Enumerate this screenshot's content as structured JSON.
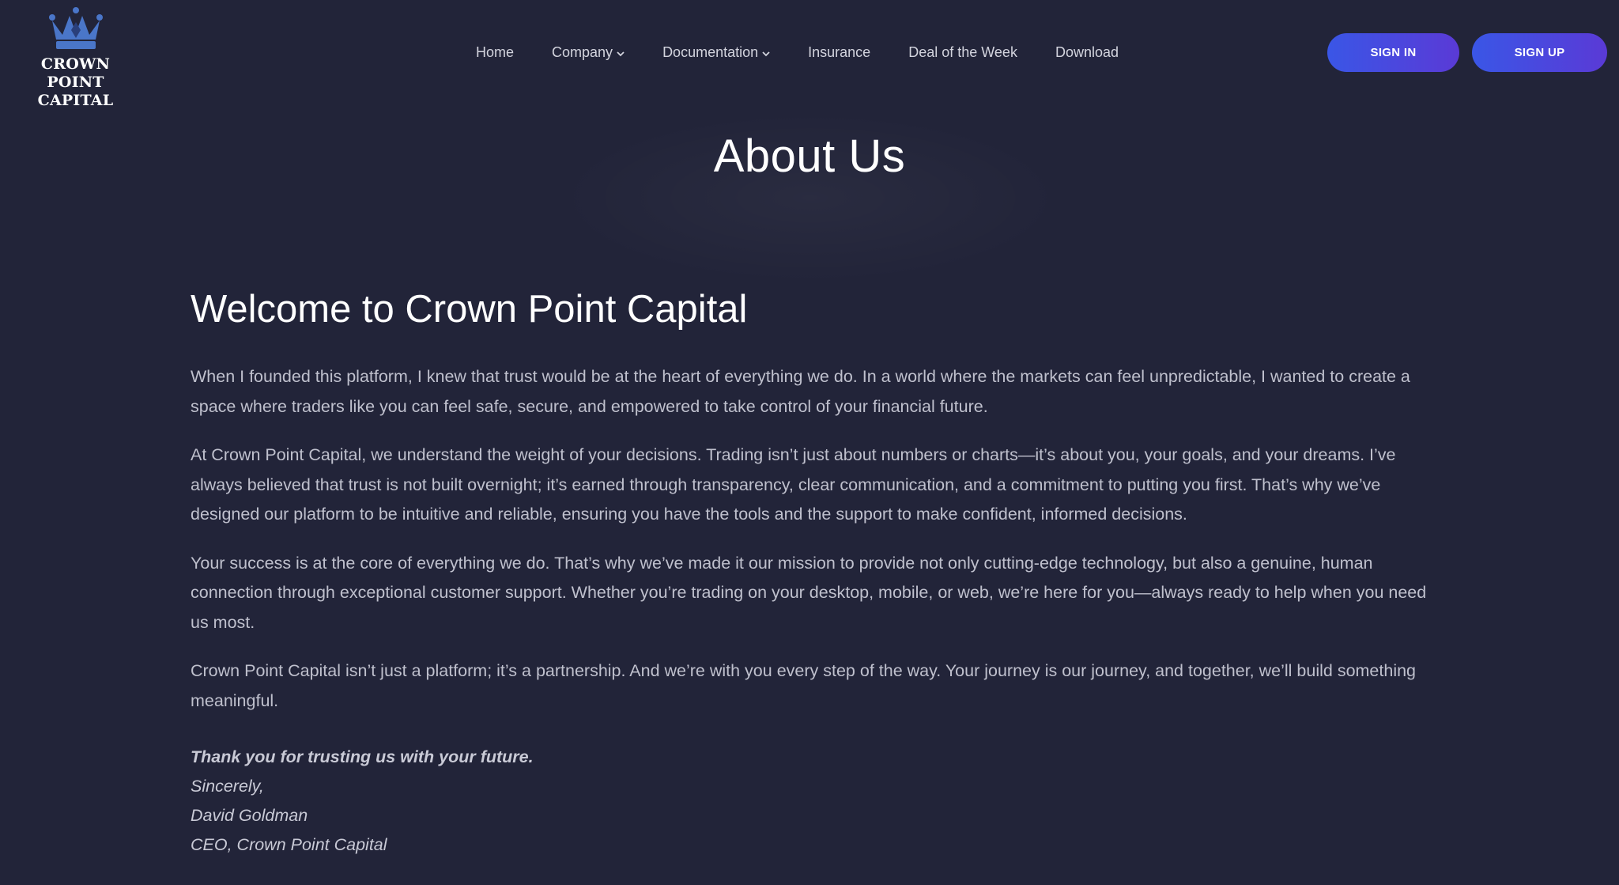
{
  "brand": {
    "logo_line1": "CROWN POINT",
    "logo_line2": "CAPITAL",
    "logo_icon": "crown-icon",
    "logo_color": "#4a76c9"
  },
  "nav": {
    "items": [
      {
        "label": "Home"
      },
      {
        "label": "Company",
        "has_dropdown": true
      },
      {
        "label": "Documentation",
        "has_dropdown": true
      },
      {
        "label": "Insurance"
      },
      {
        "label": "Deal of the Week"
      },
      {
        "label": "Download"
      }
    ]
  },
  "auth": {
    "sign_in": "SIGN IN",
    "sign_up": "SIGN UP",
    "gradient_start": "#3a56e6",
    "gradient_end": "#5a3ad6"
  },
  "hero": {
    "title": "About Us"
  },
  "about": {
    "heading": "Welcome to Crown Point Capital",
    "paragraphs": [
      "When I founded this platform, I knew that trust would be at the heart of everything we do. In a world where the markets can feel unpredictable, I wanted to create a space where traders like you can feel safe, secure, and empowered to take control of your financial future.",
      "At Crown Point Capital, we understand the weight of your decisions. Trading isn’t just about numbers or charts—it’s about you, your goals, and your dreams. I’ve always believed that trust is not built overnight; it’s earned through transparency, clear communication, and a commitment to putting you first. That’s why we’ve designed our platform to be intuitive and reliable, ensuring you have the tools and the support to make confident, informed decisions.",
      "Your success is at the core of everything we do. That’s why we’ve made it our mission to provide not only cutting-edge technology, but also a genuine, human connection through exceptional customer support. Whether you’re trading on your desktop, mobile, or web, we’re here for you—always ready to help when you need us most.",
      "Crown Point Capital isn’t just a platform; it’s a partnership. And we’re with you every step of the way. Your journey is our journey, and together, we’ll build something meaningful."
    ],
    "signoff": {
      "thanks": "Thank you for trusting us with your future.",
      "closing": "Sincerely,",
      "name": "David Goldman",
      "title": "CEO, Crown Point Capital"
    }
  },
  "colors": {
    "background": "#222439",
    "heading": "#ffffff",
    "body_text": "#bfc0cd"
  }
}
